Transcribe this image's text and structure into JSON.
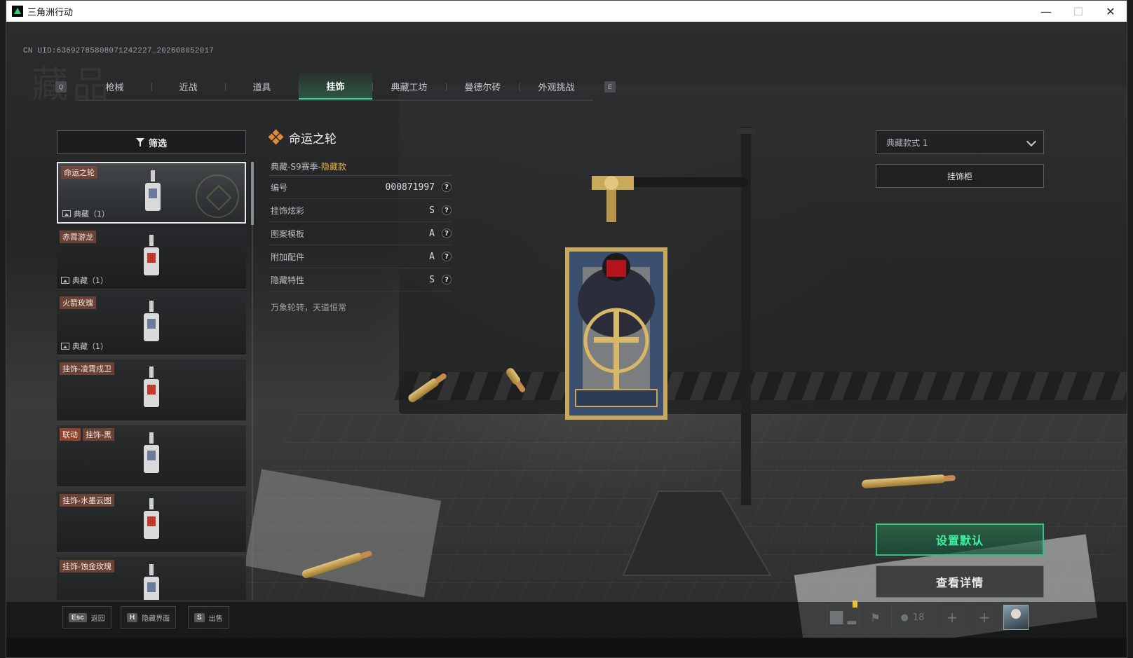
{
  "window": {
    "title": "三角洲行动",
    "controls": [
      "minimize-icon",
      "maximize-icon",
      "close-icon"
    ]
  },
  "uid_text": "CN UID:636927858080712422​27_202608052017",
  "tabs": {
    "prev_key": "Q",
    "next_key": "E",
    "items": [
      {
        "label": "枪械",
        "active": false
      },
      {
        "label": "近战",
        "active": false
      },
      {
        "label": "道具",
        "active": false
      },
      {
        "label": "挂饰",
        "active": true
      },
      {
        "label": "典藏工坊",
        "active": false
      },
      {
        "label": "曼德尔砖",
        "active": false
      },
      {
        "label": "外观挑战",
        "active": false
      }
    ]
  },
  "filter": {
    "label": "筛选",
    "icon": "funnel-icon"
  },
  "items": [
    {
      "tags": [
        "命运之轮"
      ],
      "sub": "典藏（1）",
      "selected": true
    },
    {
      "tags": [
        "赤霄游龙"
      ],
      "sub": "典藏（1）",
      "selected": false
    },
    {
      "tags": [
        "火箭玫瑰"
      ],
      "sub": "典藏（1）",
      "selected": false
    },
    {
      "tags": [
        "挂饰-凌霄戍卫"
      ],
      "sub": "",
      "selected": false
    },
    {
      "tags": [
        "联动",
        "挂饰-黑"
      ],
      "sub": "",
      "selected": false
    },
    {
      "tags": [
        "挂饰-水墨云图"
      ],
      "sub": "",
      "selected": false
    },
    {
      "tags": [
        "挂饰-蚀金玫瑰"
      ],
      "sub": "",
      "selected": false
    }
  ],
  "detail": {
    "title": "命运之轮",
    "series_prefix": "典藏-S9赛季-",
    "series_hidden": "隐藏款",
    "rows": [
      {
        "label": "编号",
        "value": "000871997"
      },
      {
        "label": "挂饰炫彩",
        "value": "S"
      },
      {
        "label": "图案模板",
        "value": "A"
      },
      {
        "label": "附加配件",
        "value": "A"
      },
      {
        "label": "隐藏特性",
        "value": "S"
      }
    ],
    "motto": "万象轮转，天道恒常"
  },
  "right_panel": {
    "style_select": "典藏款式 1",
    "cabinet_button": "挂饰柜",
    "default_button": "设置默认",
    "detail_button": "查看详情"
  },
  "hotkeys": [
    {
      "key": "Esc",
      "label": "返回"
    },
    {
      "key": "H",
      "label": "隐藏界面"
    },
    {
      "key": "S",
      "label": "出售"
    }
  ],
  "status": {
    "friends_count": "18",
    "icons": [
      "stats-icon",
      "flag-icon",
      "friends-icon",
      "add-slot-icon",
      "add-slot-icon",
      "player-avatar"
    ]
  },
  "colors": {
    "accent_green": "#30c57c",
    "hidden_gold": "#e4b34a",
    "tag_brown": "#784637"
  }
}
